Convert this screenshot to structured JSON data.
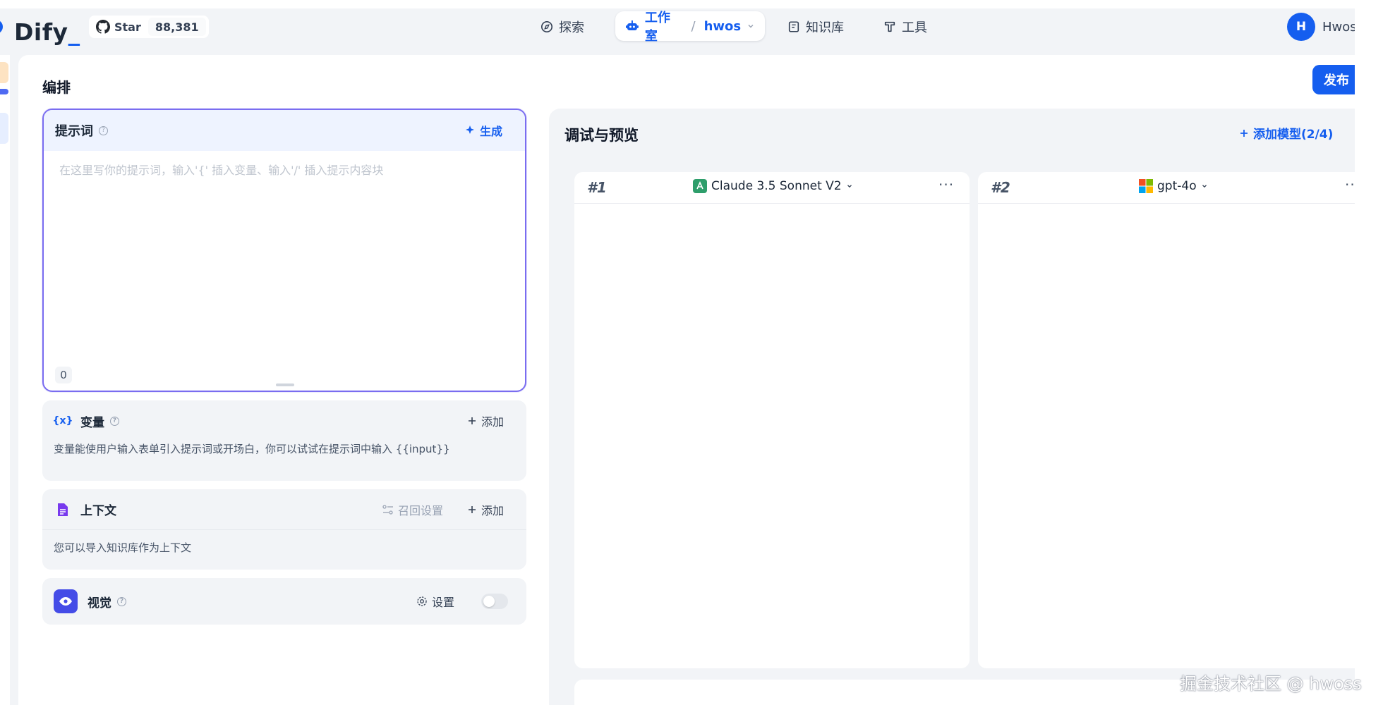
{
  "header": {
    "logo_text": "Dify",
    "github": {
      "star_label": "Star",
      "star_count": "88,381"
    },
    "nav": {
      "explore": "探索",
      "studio": "工作室",
      "workspace": "hwos",
      "knowledge": "知识库",
      "tools": "工具"
    },
    "user": {
      "initial": "H",
      "name": "Hwos"
    }
  },
  "page": {
    "title": "编排",
    "publish_label": "发布"
  },
  "prompt": {
    "title": "提示词",
    "generate_label": "生成",
    "placeholder": "在这里写你的提示词，输入'{' 插入变量、输入'/' 插入提示内容块",
    "char_count": "0"
  },
  "variables": {
    "title": "变量",
    "add_label": "添加",
    "description": "变量能使用户输入表单引入提示词或开场白，你可以试试在提示词中输入 {{input}}"
  },
  "context": {
    "title": "上下文",
    "recall_label": "召回设置",
    "add_label": "添加",
    "description": "您可以导入知识库作为上下文"
  },
  "vision": {
    "title": "视觉",
    "settings_label": "设置",
    "enabled": false
  },
  "debug": {
    "title": "调试与预览",
    "add_model_label": "添加模型(2/4)",
    "models": [
      {
        "index": "#1",
        "name": "Claude 3.5 Sonnet V2",
        "more": "···"
      },
      {
        "index": "#2",
        "name": "gpt-4o",
        "more": "···"
      }
    ]
  },
  "watermark": "掘金技术社区 @ hwoss",
  "colors": {
    "accent": "#155eef",
    "prompt_border": "#7a6df0",
    "panel_bg": "#f2f4f7"
  }
}
